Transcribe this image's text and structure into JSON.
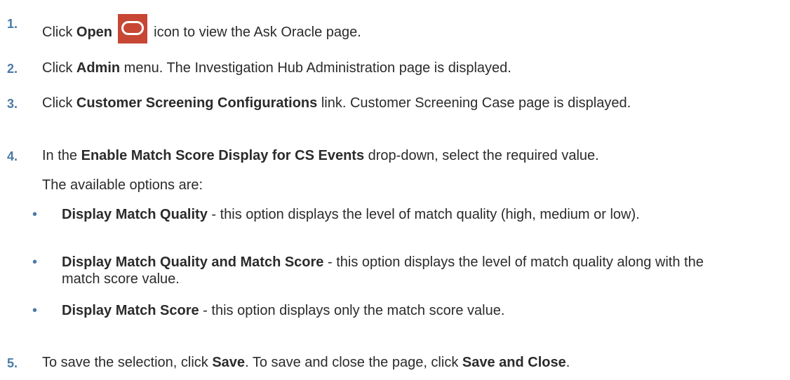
{
  "steps": [
    {
      "number": "1.",
      "pre": "Click ",
      "bold": "Open",
      "icon": "oracle-open-icon",
      "post": " icon to view the Ask Oracle page."
    },
    {
      "number": "2.",
      "pre": "Click ",
      "bold": "Admin",
      "post": " menu. The Investigation Hub Administration page is displayed."
    },
    {
      "number": "3.",
      "pre": "Click ",
      "bold": "Customer Screening Configurations",
      "post": " link. Customer Screening Case page is displayed."
    },
    {
      "number": "4.",
      "pre": "In the ",
      "bold": "Enable Match Score Display for CS Events",
      "post": " drop-down, select the required value.",
      "sub_intro": "The available options are:",
      "options": [
        {
          "bold": "Display Match Quality",
          "text": " - this option displays the level of match quality (high, medium or low)."
        },
        {
          "bold": "Display Match Quality and Match Score",
          "text": " - this option displays the level of match quality along with the match score value."
        },
        {
          "bold": "Display Match Score",
          "text": " - this option displays only the match score value."
        }
      ]
    },
    {
      "number": "5.",
      "pre": "To save the selection, click ",
      "bold": "Save",
      "mid": ". To save and close the page, click ",
      "bold2": "Save and Close",
      "post": "."
    }
  ],
  "colors": {
    "number": "#4a7aa6",
    "text": "#2b2b2b",
    "icon_bg": "#c74634"
  }
}
